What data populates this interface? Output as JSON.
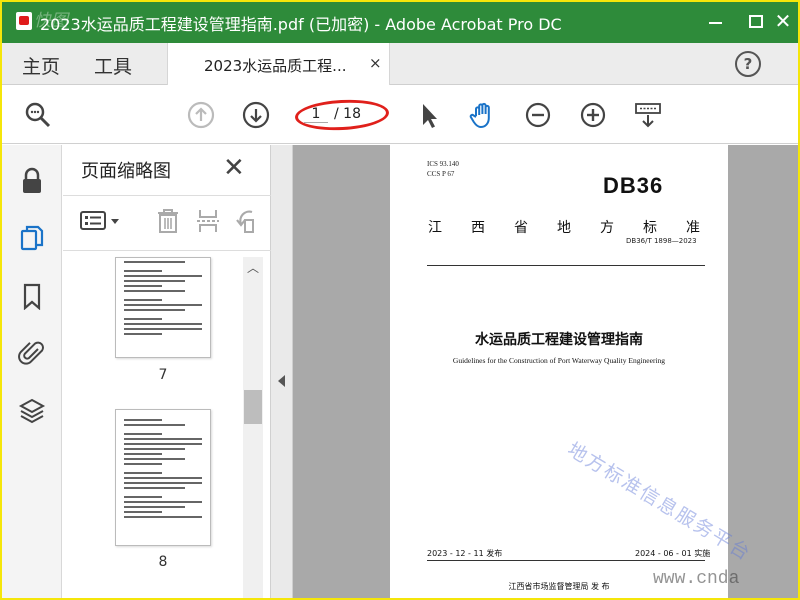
{
  "window": {
    "title": "2023水运品质工程建设管理指南.pdf (已加密) - Adobe Acrobat Pro DC",
    "watermark": "快图"
  },
  "menubar": {
    "home": "主页",
    "tools": "工具",
    "tab_label": "2023水运品质工程...",
    "tab_close": "×",
    "help": "?"
  },
  "toolbar": {
    "current_page": "1",
    "total_pages": "/ 18"
  },
  "thumbnails": {
    "title": "页面缩略图",
    "close": "✕",
    "pages": [
      {
        "number": "7"
      },
      {
        "number": "8"
      }
    ]
  },
  "document": {
    "ics": "ICS  93.140",
    "ccs": "CCS  P  67",
    "code": "DB36",
    "province_chars": [
      "江",
      "西",
      "省",
      "地",
      "方",
      "标",
      "准"
    ],
    "standard_number": "DB36/T 1898—2023",
    "title": "水运品质工程建设管理指南",
    "subtitle": "Guidelines for the Construction of Port Waterway Quality Engineering",
    "issue_date": "2023 - 12 - 11 发布",
    "implement_date": "2024 - 06 - 01 实施",
    "issuer": "江西省市场监督管理局    发 布",
    "watermark_cn": "地方标准信息服务平台",
    "watermark_url": "www.cnda"
  },
  "colors": {
    "titlebar": "#2e8b3a",
    "frame": "#f5e60a",
    "accent_blue": "#1a73c8",
    "annotation_red": "#e0201b"
  }
}
